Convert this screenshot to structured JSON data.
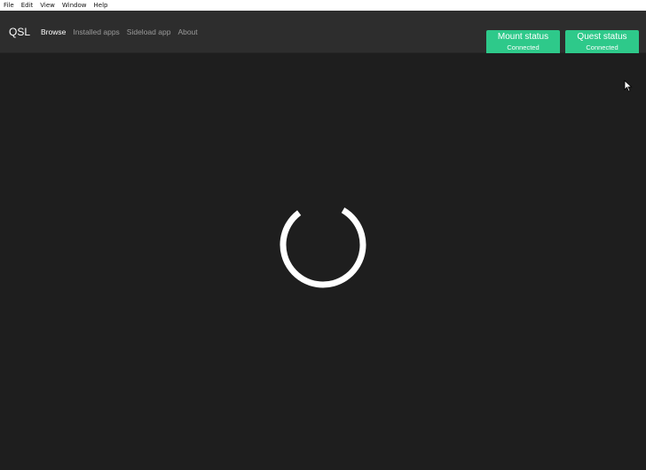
{
  "menubar": {
    "items": [
      {
        "label": "File"
      },
      {
        "label": "Edit"
      },
      {
        "label": "View"
      },
      {
        "label": "Window"
      },
      {
        "label": "Help"
      }
    ]
  },
  "navbar": {
    "brand": "QSL",
    "links": [
      {
        "label": "Browse",
        "active": true
      },
      {
        "label": "Installed apps",
        "active": false
      },
      {
        "label": "Sideload app",
        "active": false
      },
      {
        "label": "About",
        "active": false
      }
    ],
    "mount_status": {
      "title": "Mount status",
      "status": "Connected"
    },
    "quest_status": {
      "title": "Quest status",
      "status": "Connected"
    }
  },
  "content": {
    "loading_spinner_icon": "loading-spinner-icon"
  },
  "colors": {
    "background": "#1e1e1e",
    "navbar": "#2d2d2d",
    "accent": "#2ec98a",
    "menubar": "#ffffff"
  }
}
